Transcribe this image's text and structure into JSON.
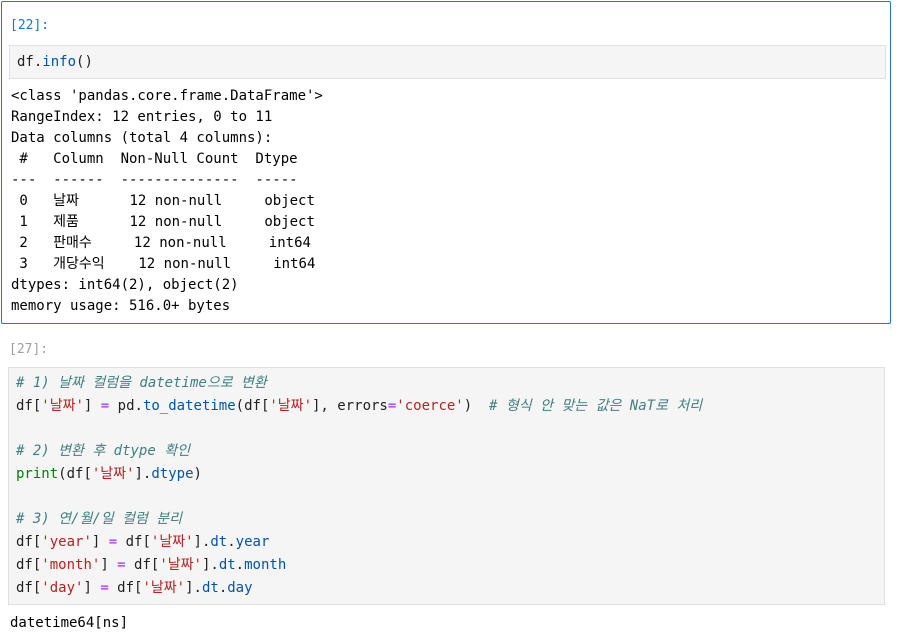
{
  "cell1": {
    "prompt": "[22]:",
    "code": {
      "obj": "df",
      "dot": ".",
      "method": "info",
      "parens": "()"
    },
    "output": [
      "<class 'pandas.core.frame.DataFrame'>",
      "RangeIndex: 12 entries, 0 to 11",
      "Data columns (total 4 columns):",
      " #   Column  Non-Null Count  Dtype ",
      "---  ------  --------------  ----- ",
      " 0   날짜      12 non-null     object",
      " 1   제품      12 non-null     object",
      " 2   판매수     12 non-null     int64 ",
      " 3   개당수익    12 non-null     int64 ",
      "dtypes: int64(2), object(2)",
      "memory usage: 516.0+ bytes"
    ]
  },
  "cell2": {
    "prompt": "[27]:",
    "comment1": "# 1) 날짜 컬럼을 datetime으로 변환",
    "line2": {
      "a": "df[",
      "s1": "'날짜'",
      "b": "] ",
      "eq": "=",
      "c": " pd.",
      "fn": "to_datetime",
      "d": "(df[",
      "s2": "'날짜'",
      "e": "], errors",
      "eq2": "=",
      "s3": "'coerce'",
      "f": ")  ",
      "cmt": "# 형식 안 맞는 값은 NaT로 처리"
    },
    "comment2": "# 2) 변환 후 dtype 확인",
    "line4": {
      "fn": "print",
      "a": "(df[",
      "s1": "'날짜'",
      "b": "].",
      "attr": "dtype",
      "c": ")"
    },
    "comment3": "# 3) 연/월/일 컬럼 분리",
    "assign_lines": [
      {
        "a": "df[",
        "s1": "'year'",
        "b": "] ",
        "eq": "=",
        "c": " df[",
        "s2": "'날짜'",
        "d": "].",
        "attr1": "dt",
        "dot": ".",
        "attr2": "year"
      },
      {
        "a": "df[",
        "s1": "'month'",
        "b": "] ",
        "eq": "=",
        "c": " df[",
        "s2": "'날짜'",
        "d": "].",
        "attr1": "dt",
        "dot": ".",
        "attr2": "month"
      },
      {
        "a": "df[",
        "s1": "'day'",
        "b": "] ",
        "eq": "=",
        "c": " df[",
        "s2": "'날짜'",
        "d": "].",
        "attr1": "dt",
        "dot": ".",
        "attr2": "day"
      }
    ],
    "output": "datetime64[ns]"
  }
}
